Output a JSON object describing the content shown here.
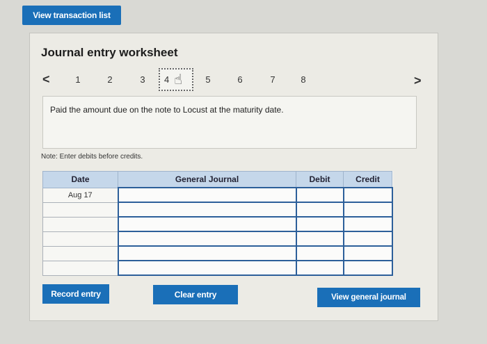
{
  "header": {
    "view_transaction_list": "View transaction list"
  },
  "worksheet": {
    "title": "Journal entry worksheet",
    "pages": [
      "1",
      "2",
      "3",
      "4",
      "5",
      "6",
      "7",
      "8"
    ],
    "active_page": "4",
    "description": "Paid the amount due on the note to Locust at the maturity date.",
    "note": "Note: Enter debits before credits."
  },
  "table": {
    "headers": {
      "date": "Date",
      "journal": "General Journal",
      "debit": "Debit",
      "credit": "Credit"
    },
    "rows": [
      {
        "date": "Aug 17",
        "account": "",
        "debit": "",
        "credit": ""
      },
      {
        "date": "",
        "account": "",
        "debit": "",
        "credit": ""
      },
      {
        "date": "",
        "account": "",
        "debit": "",
        "credit": ""
      },
      {
        "date": "",
        "account": "",
        "debit": "",
        "credit": ""
      },
      {
        "date": "",
        "account": "",
        "debit": "",
        "credit": ""
      },
      {
        "date": "",
        "account": "",
        "debit": "",
        "credit": ""
      }
    ]
  },
  "buttons": {
    "record_entry": "Record entry",
    "clear_entry": "Clear entry",
    "view_general_journal": "View general journal"
  },
  "icons": {
    "prev": "chevron-left-icon",
    "next": "chevron-right-icon",
    "cursor": "hand-pointer-icon"
  },
  "colors": {
    "button": "#1a6fb8",
    "table_header": "#c5d7ea",
    "field_border": "#2c5f9a"
  }
}
